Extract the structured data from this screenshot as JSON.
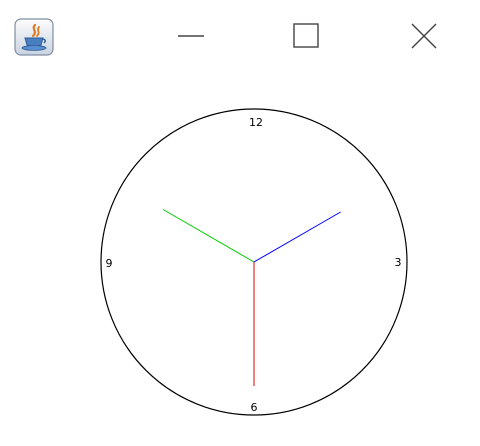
{
  "window": {
    "app_icon": "java-coffee-cup-icon",
    "controls": {
      "minimize_icon": "minimize-icon",
      "maximize_icon": "maximize-icon",
      "close_icon": "close-icon"
    }
  },
  "clock": {
    "numerals": {
      "twelve": "12",
      "three": "3",
      "six": "6",
      "nine": "9"
    },
    "hands": {
      "hour": {
        "color": "#00cc00",
        "minutes_position": 50
      },
      "minute": {
        "color": "#0000ff",
        "minutes_position": 10
      },
      "second": {
        "color": "#e00000",
        "minutes_position": 30
      }
    }
  }
}
